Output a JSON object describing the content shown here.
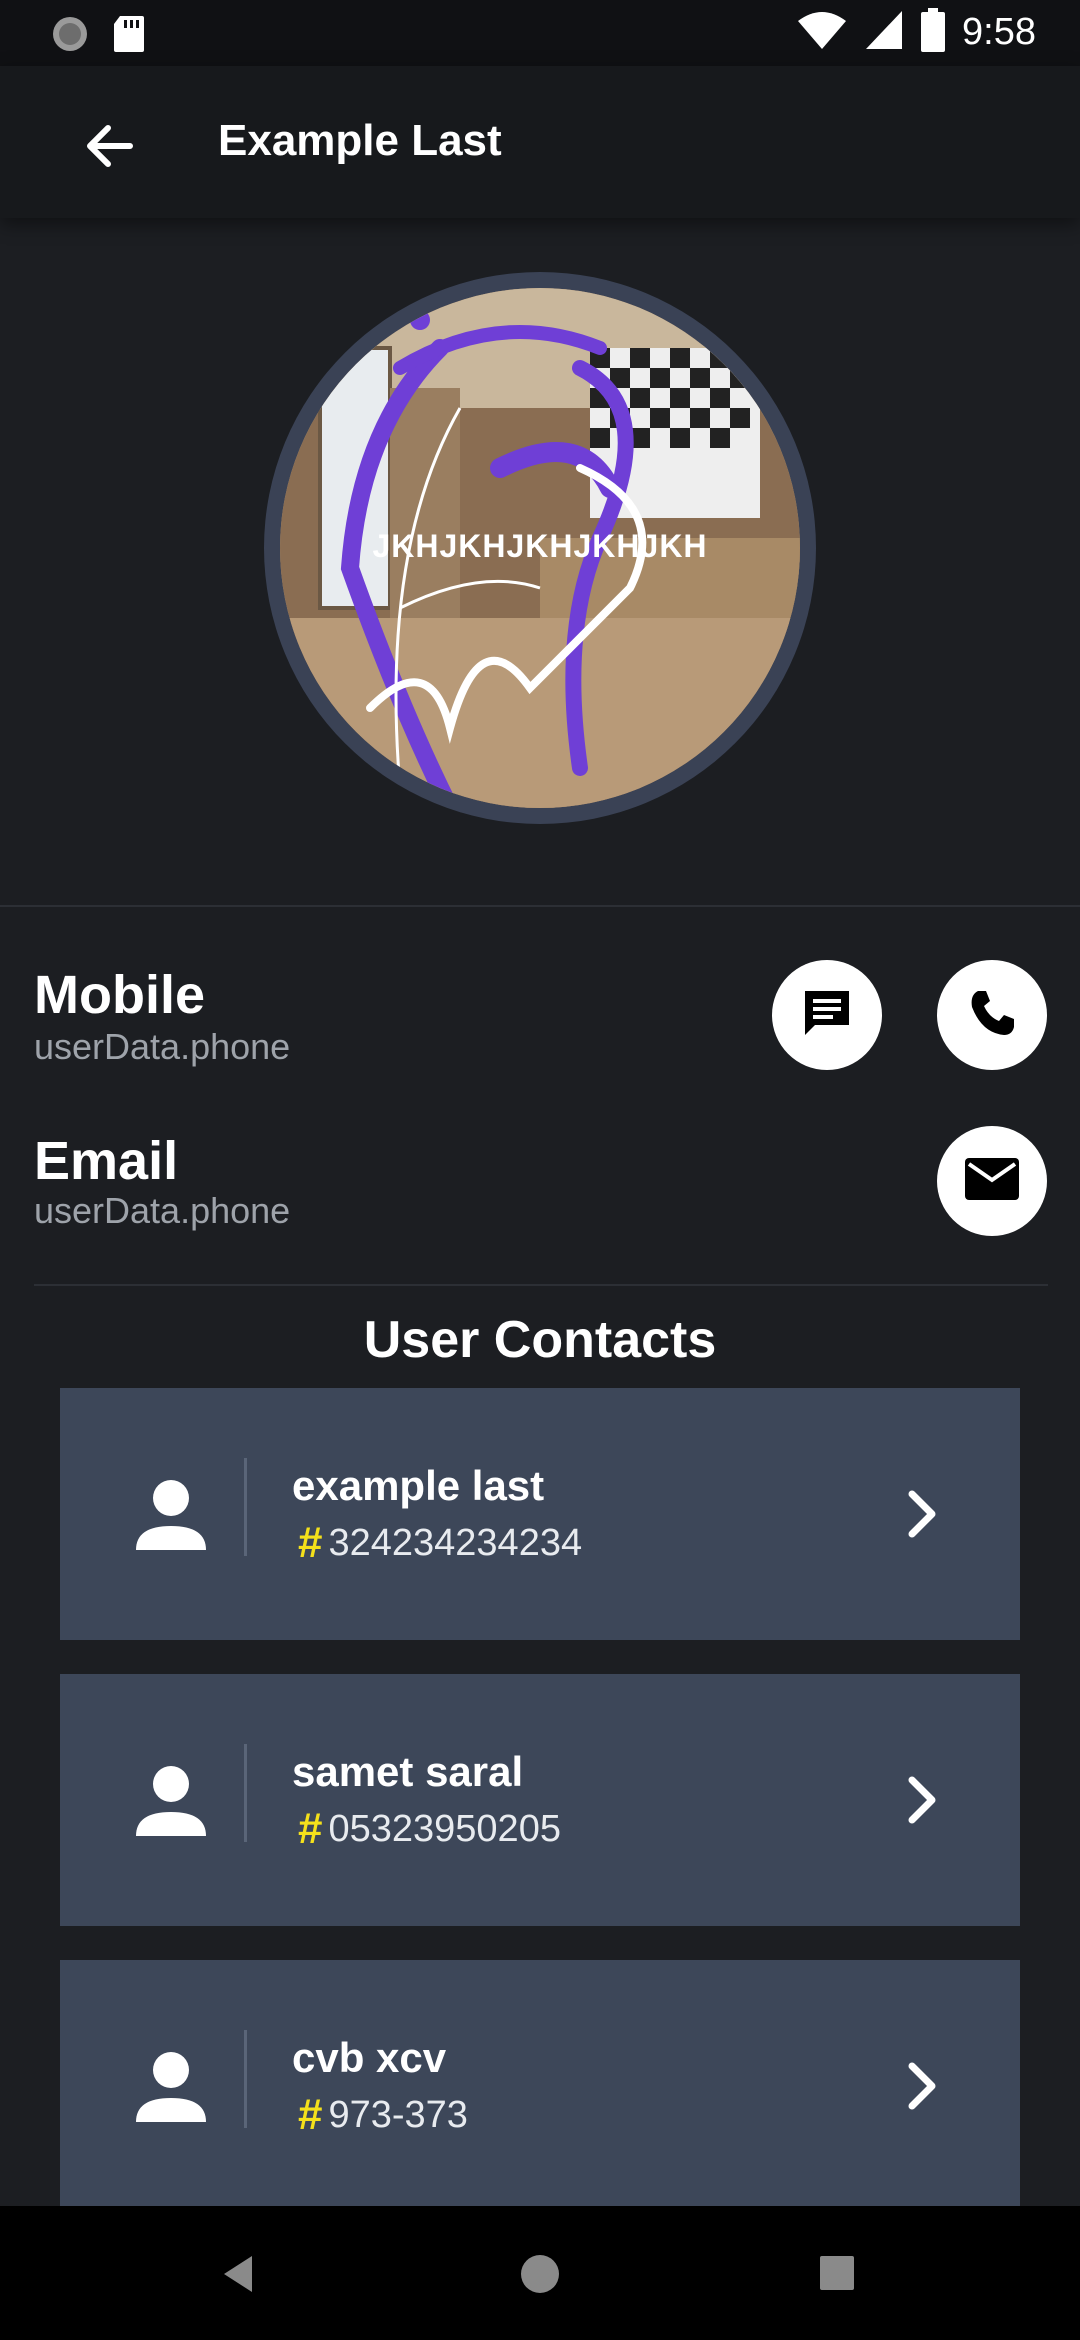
{
  "status_bar": {
    "time": "9:58",
    "icons": [
      "sync-icon",
      "sd-card-icon",
      "wifi-icon",
      "signal-icon",
      "battery-icon"
    ]
  },
  "app_bar": {
    "title": "Example Last",
    "back_icon": "arrow-back-icon"
  },
  "avatar": {
    "overlay_text": "JKHJKHJKHJKHJKH"
  },
  "info": {
    "mobile_label": "Mobile",
    "mobile_value": "userData.phone",
    "email_label": "Email",
    "email_value": "userData.phone"
  },
  "contacts": {
    "title": "User Contacts",
    "items": [
      {
        "name": "example last",
        "phone": "324234234234"
      },
      {
        "name": "samet saral",
        "phone": "05323950205"
      },
      {
        "name": "cvb xcv",
        "phone": "973-373"
      }
    ]
  },
  "symbols": {
    "hash": "#"
  },
  "colors": {
    "background": "#1c1e22",
    "card": "#3d4759",
    "hash_accent": "#f4e01b",
    "avatar_ring": "#3a4255"
  }
}
